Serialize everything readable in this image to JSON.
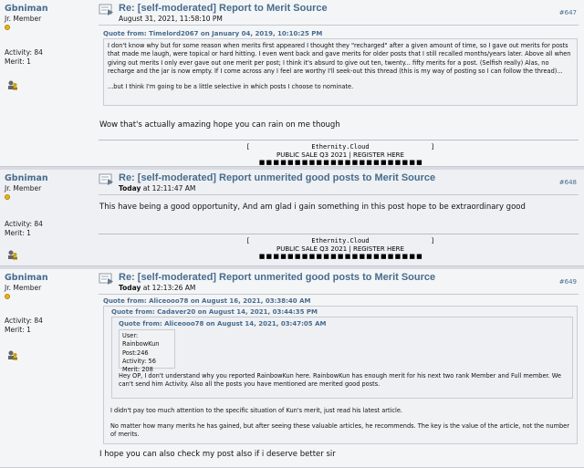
{
  "posts": [
    {
      "author": "Gbniman",
      "rank": "Jr. Member",
      "activity_label": "Activity: 84",
      "merit_label": "Merit: 1",
      "title": "Re: [self-moderated] Report to Merit Source",
      "date": "August 31, 2021, 11:58:10 PM",
      "number": "#647",
      "quote_header": "Quote from: Timelord2067 on January 04, 2019, 10:10:25 PM",
      "quote_p1": "I don't know why but for some reason when merits first appeared I thought they \"recharged\" after a given amount of time, so I gave out merits for posts that made me laugh, were topical or hard hitting. I even went back and gave merits for older posts that I still recalled months/years later. Above all when giving out merits I only ever gave out one merit per post; I think it's absurd to give out ten, twenty... fifty merits for a post. (Selfish really) Alas, no recharge and the jar is now empty.  If I come across any I feel are worthy I'll seek-out this thread (this is my way of posting so I can follow the thread)...",
      "quote_p2": "...but I think I'm going to be a little selective in which posts I choose to nominate.",
      "message": "Wow that's actually amazing hope you can rain on me though"
    },
    {
      "author": "Gbniman",
      "rank": "Jr. Member",
      "activity_label": "Activity: 84",
      "merit_label": "Merit: 1",
      "title": "Re: [self-moderated] Report unmerited good posts to Merit Source",
      "date_prefix": "Today",
      "date": " at 12:11:47 AM",
      "number": "#648",
      "message": "This have being a good opportunity, And am glad i gain something in this post hope to be extraordinary good"
    },
    {
      "author": "Gbniman",
      "rank": "Jr. Member",
      "activity_label": "Activity: 84",
      "merit_label": "Merit: 1",
      "title": "Re: [self-moderated] Report unmerited good posts to Merit Source",
      "date_prefix": "Today",
      "date": " at 12:13:26 AM",
      "number": "#649",
      "quote_header_1": "Quote from: Aliceooo78 on August 16, 2021, 03:38:40 AM",
      "quote_header_2": "Quote from: Cadaver20 on August 14, 2021, 03:44:35 PM",
      "quote_header_3": "Quote from: Aliceooo78 on August 14, 2021, 03:47:05 AM",
      "stats_user": "User: RainbowKun",
      "stats_post": "Post:246",
      "stats_activity": "Activity: 56",
      "stats_merit": "Merit: 208",
      "quote_2_text": "Hey OP, I don't understand why you reported RainbowKun here. RainbowKun has enough merit for his next two rank Member and Full member. We can't send him Activity. Also all the posts you have mentioned are merited good posts.",
      "quote_1_p1": "I didn't pay too much attention to the specific situation of Kun's merit, just read his latest article.",
      "quote_1_p2": "No matter how many merits he has gained, but after seeing these valuable articles, he recommends. The key is the value of the article, not the number of merits.",
      "message": "I hope you can also check my post also if i deserve better sir"
    }
  ],
  "signature": {
    "line1": "[                Ethernity.Cloud                ]",
    "line2": "PUBLIC SALE Q3 2021   |   REGISTER HERE",
    "line3": "■ ■ ■ ■ ■ ■ ■ ■ ■ ■ ■ ■   ■ ■ ■ ■ ■ ■ ■ ■ ■ ■ ■"
  },
  "colors": {
    "link": "#476c8e",
    "star": "#e9b31b",
    "background": "#e5e8ec"
  }
}
